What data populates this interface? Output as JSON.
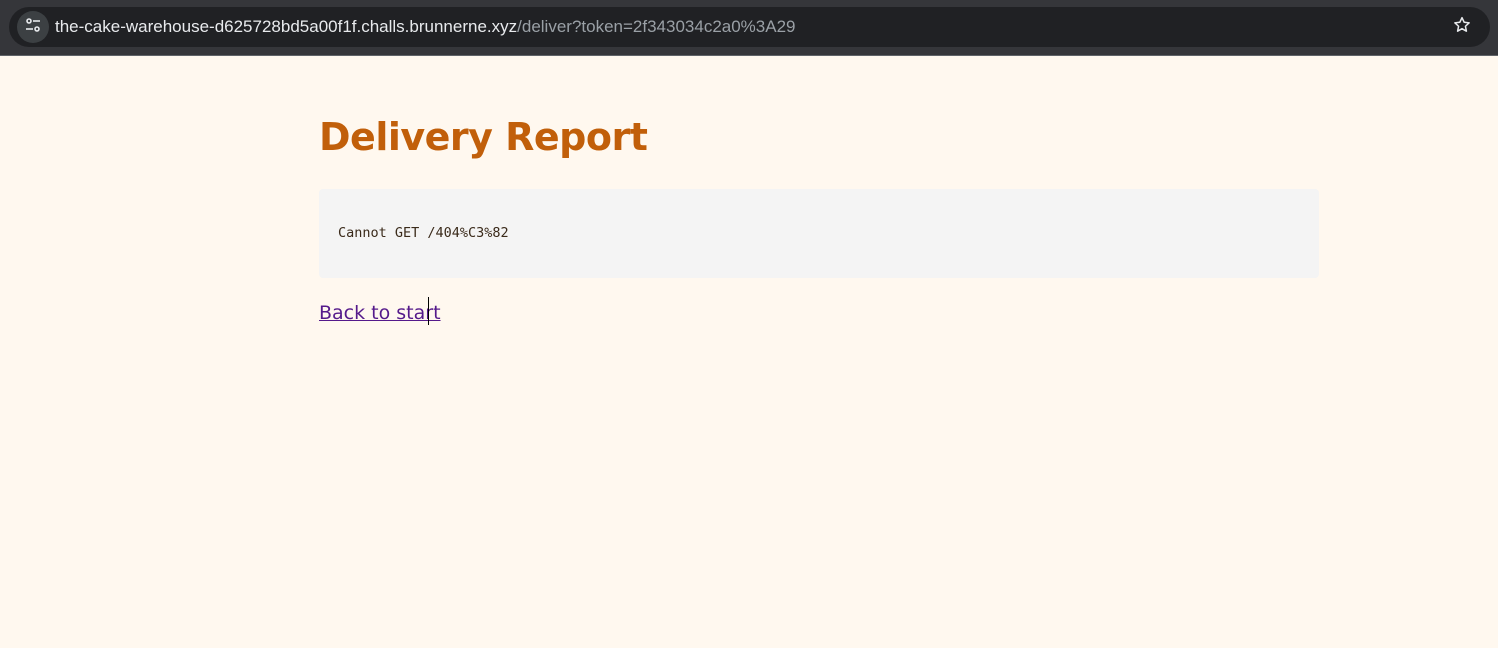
{
  "browser": {
    "url_host": "the-cake-warehouse-d625728bd5a00f1f.challs.brunnerne.xyz",
    "url_path": "/deliver?token=2f343034c2a0%3A29",
    "site_info_icon": "tune-icon",
    "bookmark_icon": "star-outline-icon"
  },
  "page": {
    "title": "Delivery Report",
    "report_text": "Cannot GET /404%C3%82",
    "back_link_label": "Back to start"
  },
  "colors": {
    "title": "#c15f0a",
    "background": "#fff8ef",
    "report_box": "#f4f4f4",
    "link_visited": "#551a8b"
  }
}
